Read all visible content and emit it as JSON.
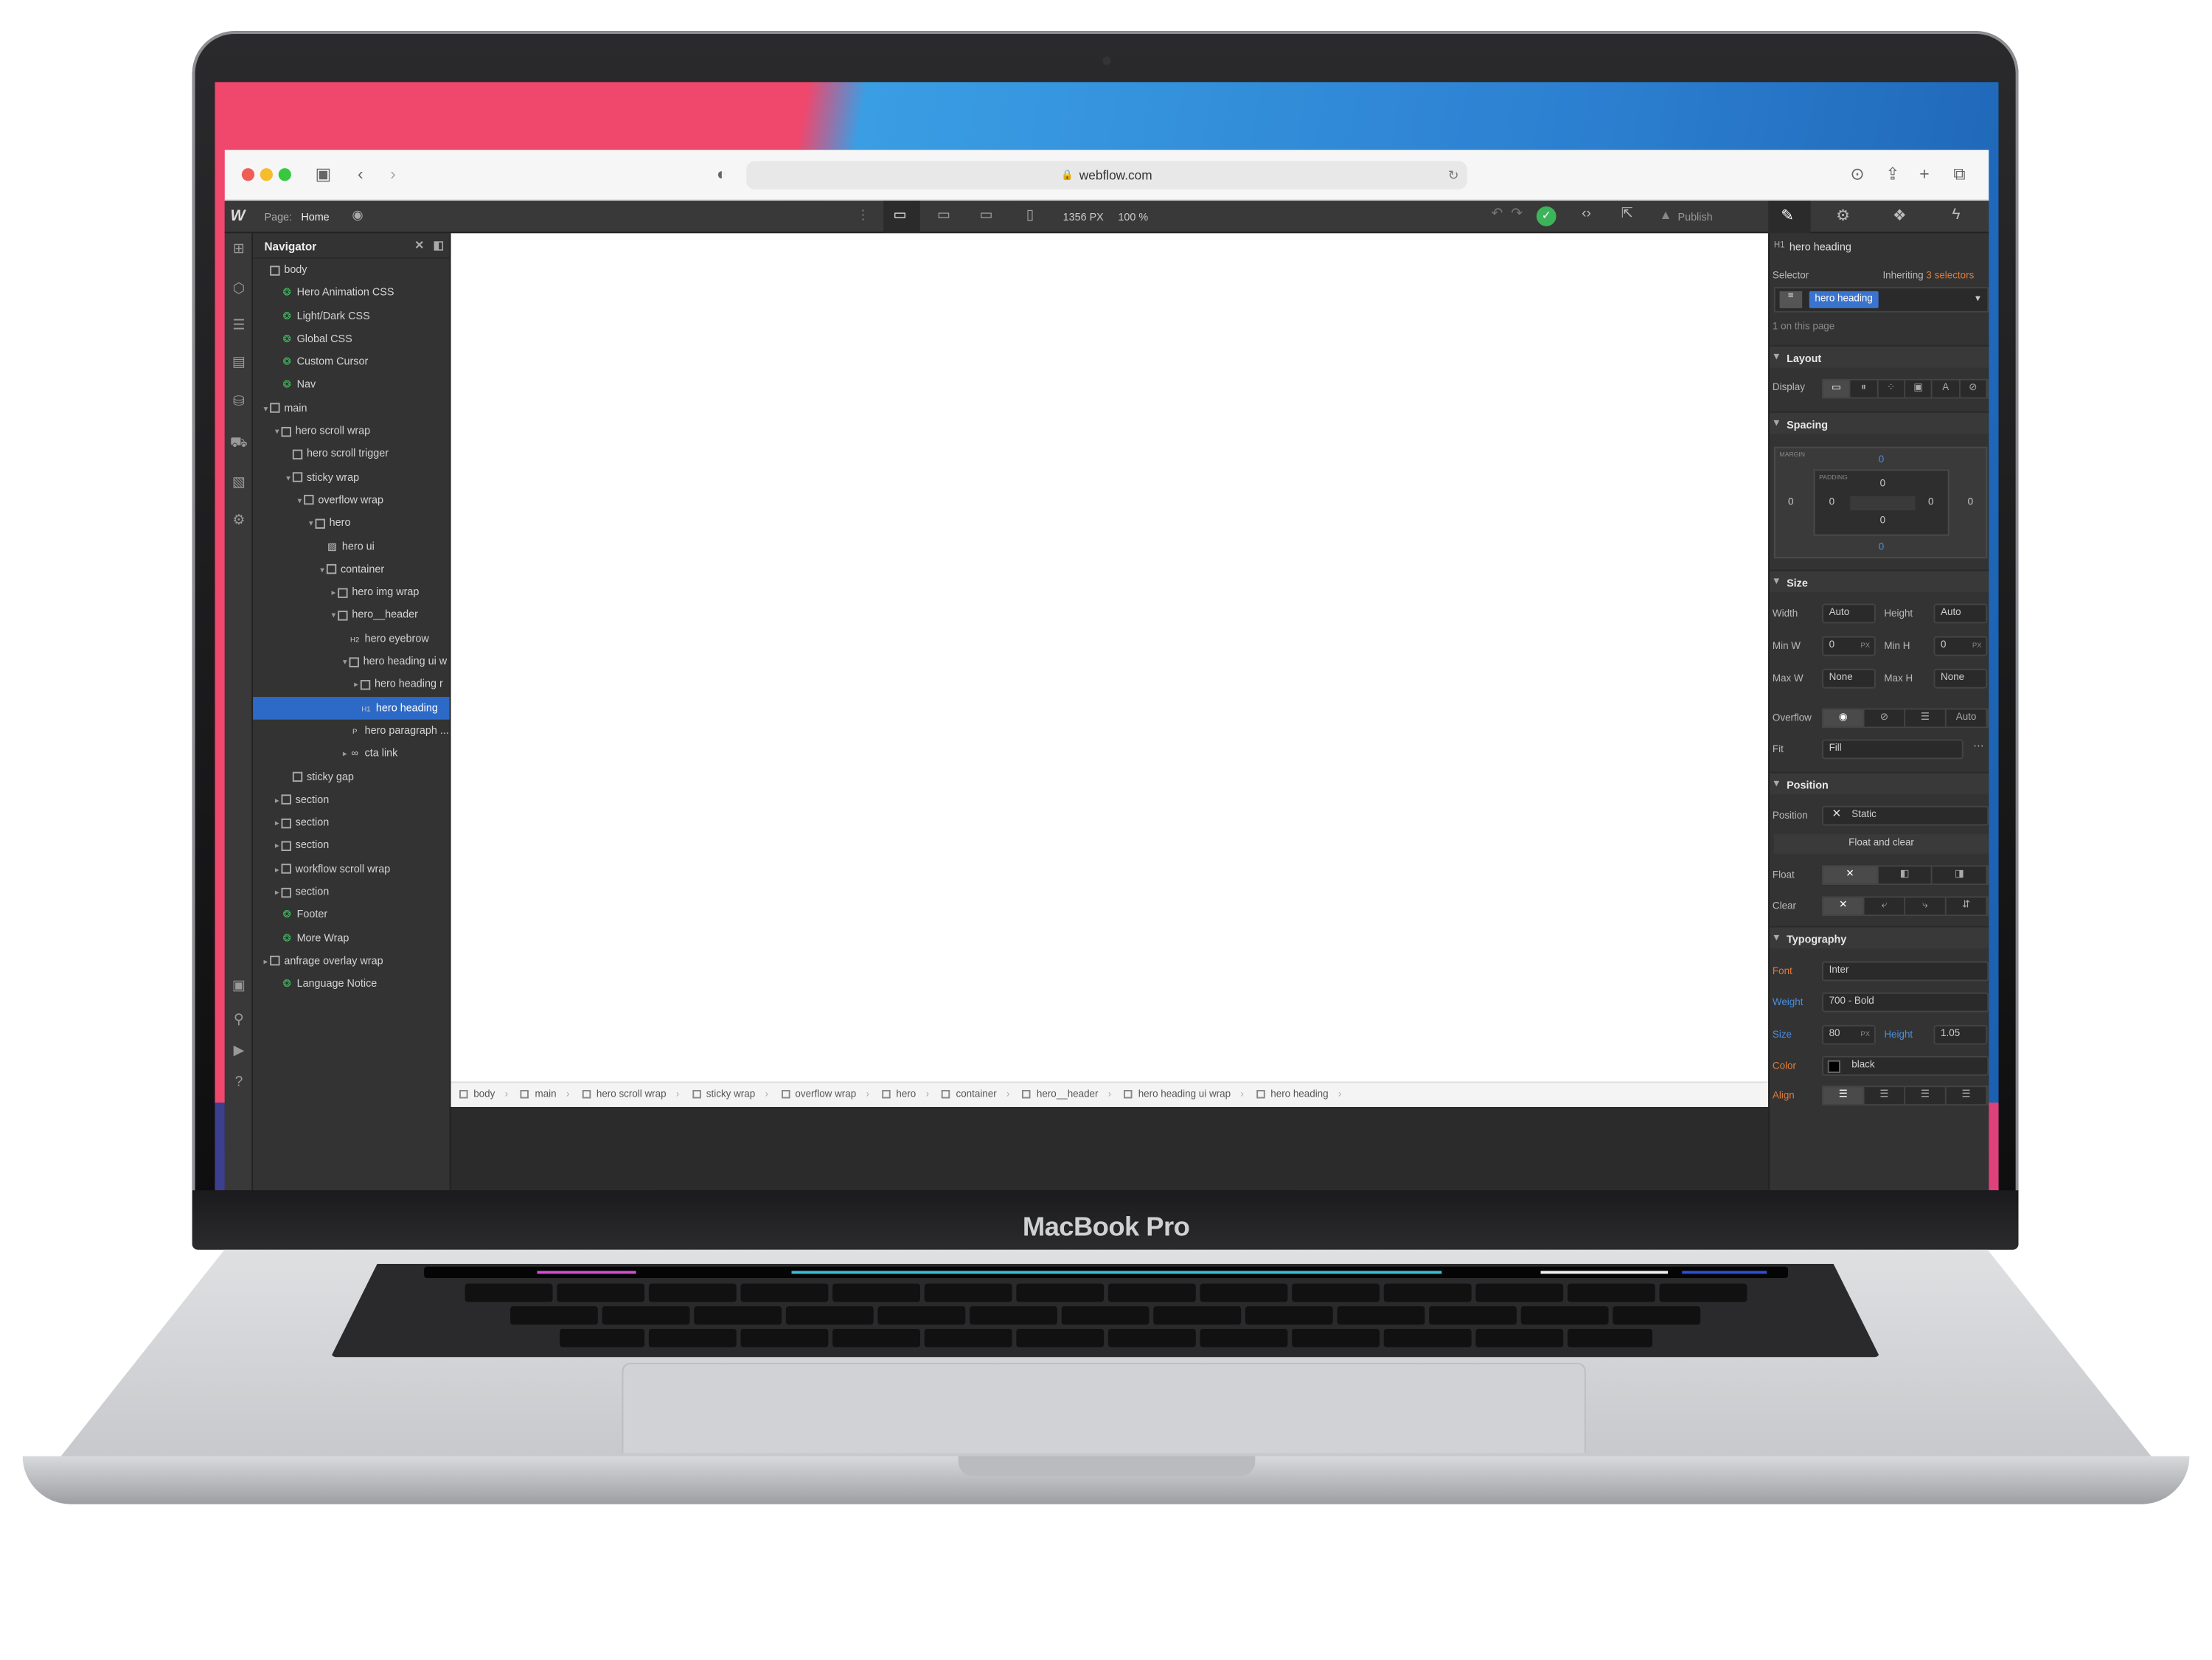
{
  "device": {
    "brand": "MacBook Pro"
  },
  "browser": {
    "url": "webflow.com",
    "traffic_lights": [
      "#ee5e57",
      "#f5bd2e",
      "#37c840"
    ]
  },
  "designer": {
    "page_label": "Page:",
    "page_name": "Home",
    "canvas_width": "1356",
    "canvas_width_unit": "PX",
    "zoom": "100 %",
    "publish_label": "Publish",
    "navigator": {
      "title": "Navigator",
      "items": [
        {
          "label": "body",
          "kind": "box",
          "level": 0,
          "twist": ""
        },
        {
          "label": "Hero Animation CSS",
          "kind": "symbol",
          "level": 1,
          "twist": ""
        },
        {
          "label": "Light/Dark CSS",
          "kind": "symbol",
          "level": 1,
          "twist": ""
        },
        {
          "label": "Global CSS",
          "kind": "symbol",
          "level": 1,
          "twist": ""
        },
        {
          "label": "Custom Cursor",
          "kind": "symbol",
          "level": 1,
          "twist": ""
        },
        {
          "label": "Nav",
          "kind": "symbol",
          "level": 1,
          "twist": ""
        },
        {
          "label": "main",
          "kind": "box",
          "level": 0,
          "twist": "▾"
        },
        {
          "label": "hero scroll wrap",
          "kind": "box",
          "level": 1,
          "twist": "▾"
        },
        {
          "label": "hero scroll trigger",
          "kind": "box",
          "level": 2,
          "twist": ""
        },
        {
          "label": "sticky wrap",
          "kind": "box",
          "level": 2,
          "twist": "▾"
        },
        {
          "label": "overflow wrap",
          "kind": "box",
          "level": 3,
          "twist": "▾"
        },
        {
          "label": "hero",
          "kind": "box",
          "level": 4,
          "twist": "▾"
        },
        {
          "label": "hero ui",
          "kind": "image",
          "level": 5,
          "twist": ""
        },
        {
          "label": "container",
          "kind": "box",
          "level": 5,
          "twist": "▾"
        },
        {
          "label": "hero img wrap",
          "kind": "box",
          "level": 6,
          "twist": "▸"
        },
        {
          "label": "hero__header",
          "kind": "box",
          "level": 6,
          "twist": "▾"
        },
        {
          "label": "hero eyebrow",
          "kind": "h2",
          "level": 7,
          "twist": ""
        },
        {
          "label": "hero heading ui w",
          "kind": "box",
          "level": 7,
          "twist": "▾"
        },
        {
          "label": "hero heading r",
          "kind": "box",
          "level": 8,
          "twist": "▸"
        },
        {
          "label": "hero heading",
          "kind": "h1",
          "level": 8,
          "twist": "",
          "selected": true
        },
        {
          "label": "hero paragraph ...",
          "kind": "p",
          "level": 7,
          "twist": ""
        },
        {
          "label": "cta link",
          "kind": "link",
          "level": 7,
          "twist": "▸"
        },
        {
          "label": "sticky gap",
          "kind": "box",
          "level": 2,
          "twist": ""
        },
        {
          "label": "section",
          "kind": "box",
          "level": 1,
          "twist": "▸"
        },
        {
          "label": "section",
          "kind": "box",
          "level": 1,
          "twist": "▸"
        },
        {
          "label": "section",
          "kind": "box",
          "level": 1,
          "twist": "▸"
        },
        {
          "label": "workflow scroll wrap",
          "kind": "box",
          "level": 1,
          "twist": "▸"
        },
        {
          "label": "section",
          "kind": "box",
          "level": 1,
          "twist": "▸"
        },
        {
          "label": "Footer",
          "kind": "symbol",
          "level": 1,
          "twist": ""
        },
        {
          "label": "More Wrap",
          "kind": "symbol",
          "level": 1,
          "twist": ""
        },
        {
          "label": "anfrage overlay wrap",
          "kind": "box",
          "level": 0,
          "twist": "▸"
        },
        {
          "label": "Language Notice",
          "kind": "symbol",
          "level": 1,
          "twist": ""
        }
      ]
    },
    "breadcrumbs": [
      "body",
      "main",
      "hero scroll wrap",
      "sticky wrap",
      "overflow wrap",
      "hero",
      "container",
      "hero__header",
      "hero heading ui wrap",
      "hero heading"
    ],
    "style_panel": {
      "element_tag": "H1",
      "element_name": "hero heading",
      "selector_label": "Selector",
      "inheriting_label": "Inheriting",
      "inheriting_count": "3 selectors",
      "selector_chip": "hero heading",
      "on_page": "1 on this page",
      "layout": {
        "title": "Layout",
        "display_label": "Display"
      },
      "spacing": {
        "title": "Spacing",
        "margin_label": "MARGIN",
        "padding_label": "PADDING",
        "margin": {
          "top": "0",
          "right": "0",
          "bottom": "0",
          "left": "0"
        },
        "padding": {
          "top": "0",
          "right": "0",
          "bottom": "0",
          "left": "0"
        }
      },
      "size": {
        "title": "Size",
        "width_label": "Width",
        "width": "Auto",
        "height_label": "Height",
        "height": "Auto",
        "minw_label": "Min W",
        "minw": "0",
        "minw_unit": "PX",
        "minh_label": "Min H",
        "minh": "0",
        "minh_unit": "PX",
        "maxw_label": "Max W",
        "maxw": "None",
        "maxh_label": "Max H",
        "maxh": "None",
        "overflow_label": "Overflow",
        "overflow_auto": "Auto",
        "fit_label": "Fit",
        "fit": "Fill"
      },
      "position": {
        "title": "Position",
        "position_label": "Position",
        "position": "Static",
        "float_clear_label": "Float and clear",
        "float_label": "Float",
        "clear_label": "Clear"
      },
      "typography": {
        "title": "Typography",
        "font_label": "Font",
        "font": "Inter",
        "weight_label": "Weight",
        "weight": "700 - Bold",
        "size_label": "Size",
        "size": "80",
        "size_unit": "PX",
        "height_label": "Height",
        "height": "1.05",
        "color_label": "Color",
        "color": "black",
        "align_label": "Align"
      }
    }
  }
}
